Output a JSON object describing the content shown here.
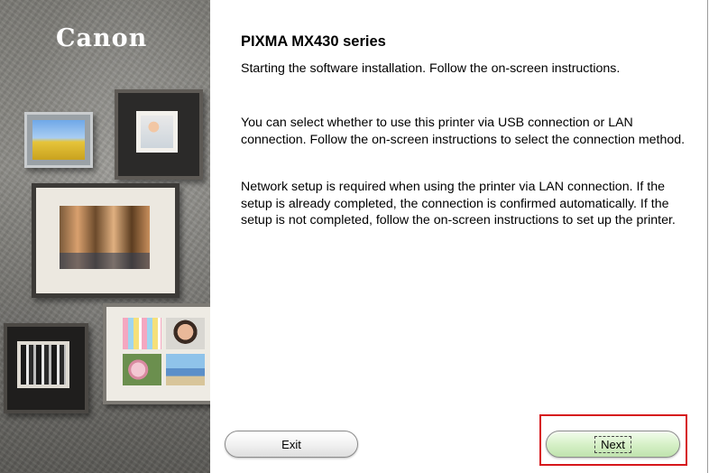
{
  "sidebar": {
    "brand": "Canon"
  },
  "main": {
    "title": "PIXMA MX430 series",
    "paragraphs": [
      "Starting the software installation. Follow the on-screen instructions.",
      "You can select whether to use this printer via USB connection or LAN connection. Follow the on-screen instructions to select the connection method.",
      "Network setup is required when using the printer via LAN connection. If the setup is already completed, the connection is confirmed automatically. If the setup is not completed, follow the on-screen instructions to set up the printer."
    ]
  },
  "buttons": {
    "exit_label": "Exit",
    "next_label": "Next"
  },
  "colors": {
    "next_button_green": "#d7f1c8",
    "highlight_red": "#d6161b"
  }
}
